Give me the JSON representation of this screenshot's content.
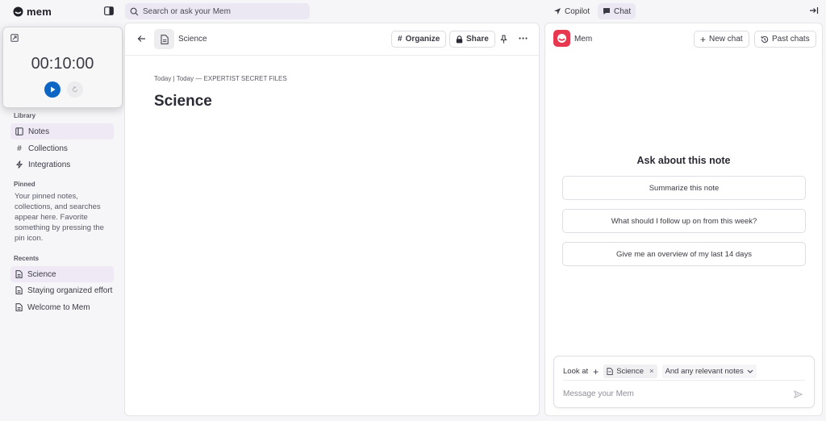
{
  "app": {
    "name": "mem"
  },
  "search": {
    "placeholder": "Search or ask your Mem"
  },
  "modes": {
    "copilot": "Copilot",
    "chat": "Chat"
  },
  "timer": {
    "display": "00:10:00"
  },
  "sidebar": {
    "library_heading": "Library",
    "library_items": [
      {
        "label": "Notes",
        "icon": "notes-icon",
        "active": true
      },
      {
        "label": "Collections",
        "icon": "hash-icon",
        "active": false
      },
      {
        "label": "Integrations",
        "icon": "bolt-icon",
        "active": false
      }
    ],
    "pinned_heading": "Pinned",
    "pinned_empty": "Your pinned notes, collections, and searches appear here. Favorite something by pressing the pin icon.",
    "recents_heading": "Recents",
    "recents": [
      {
        "label": "Science",
        "icon": "document-icon",
        "active": true
      },
      {
        "label": "Staying organized effort",
        "icon": "document-icon",
        "active": false
      },
      {
        "label": "Welcome to Mem",
        "icon": "document-icon",
        "active": false
      }
    ]
  },
  "note": {
    "breadcrumb": "Science",
    "actions": {
      "organize": "Organize",
      "share": "Share"
    },
    "meta": "Today | Today — EXPERTIST SECRET FILES",
    "title": "Science"
  },
  "chat": {
    "name": "Mem",
    "new_chat": "New chat",
    "past_chats": "Past chats",
    "heading": "Ask about this note",
    "suggestions": [
      "Summarize this note",
      "What should I follow up on from this week?",
      "Give me an overview of my last 14 days"
    ],
    "composer": {
      "look_at": "Look at",
      "chip": "Science",
      "scope": "And any relevant notes",
      "placeholder": "Message your Mem"
    }
  },
  "colors": {
    "accent": "#0d66c4",
    "brand": "#e8384f",
    "active_bg": "#efe9f5"
  }
}
